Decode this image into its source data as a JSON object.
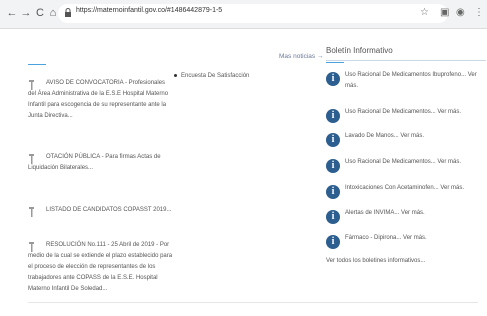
{
  "browser": {
    "url": "https://maternoinfantil.gov.co/#1486442879-1-5"
  },
  "main": {
    "more_news": "Mas noticias →",
    "news": [
      {
        "text": "AVISO DE CONVOCATORIA - Profesionales del Área Administrativa de la E.S.E Hospital Materno Infantil para escogencia de su representante ante la Junta Directiva..."
      },
      {
        "text": "OTACIÓN PÚBLICA - Para firmas Actas de Liquidación Bilaterales..."
      },
      {
        "text": "LISTADO DE CANDIDATOS COPASST 2019..."
      },
      {
        "text": "RESOLUCIÓN No.111 - 25 Abril de 2019 - Por medio de la cual se extiende el plazo establecido para el proceso de elección de representantes de los trabajadores ante COPASS de la E.S.E. Hospital Materno Infantil De Soledad..."
      }
    ],
    "survey": "Encuesta De Satisfacción"
  },
  "sidebar": {
    "title": "Boletín Informativo",
    "items": [
      {
        "text": "Uso Racional De Medicamentos Ibuprofeno... Ver más."
      },
      {
        "text": "Uso Racional De Medicamentos... Ver más."
      },
      {
        "text": "Lavado De Manos... Ver más."
      },
      {
        "text": "Uso Racional De Medicamentos... Ver más."
      },
      {
        "text": "Intoxicaciones Con Acetaminofen... Ver más."
      },
      {
        "text": "Alertas de INVIMA... Ver más."
      },
      {
        "text": "Fármaco - Dipirona... Ver más."
      }
    ],
    "all_link": "Ver todos los boletines informativos..."
  }
}
